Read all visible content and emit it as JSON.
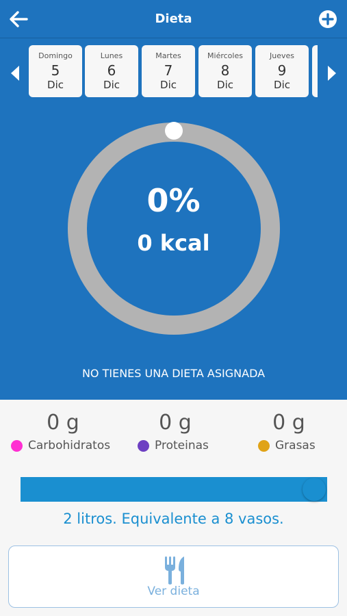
{
  "header": {
    "title": "Dieta",
    "back_icon": "arrow-left-icon",
    "add_icon": "plus-circle-icon"
  },
  "days": [
    {
      "name": "Domingo",
      "number": "5",
      "month": "Dic"
    },
    {
      "name": "Lunes",
      "number": "6",
      "month": "Dic"
    },
    {
      "name": "Martes",
      "number": "7",
      "month": "Dic"
    },
    {
      "name": "Miércoles",
      "number": "8",
      "month": "Dic"
    },
    {
      "name": "Jueves",
      "number": "9",
      "month": "Dic"
    }
  ],
  "summary": {
    "percent_label": "0%",
    "percent_value": 0,
    "kcal": "0 kcal",
    "notice": "NO TIENES UNA DIETA ASIGNADA"
  },
  "macros": [
    {
      "value": "0 g",
      "label": "Carbohidratos",
      "color": "#ff2fd2"
    },
    {
      "value": "0 g",
      "label": "Proteinas",
      "color": "#6d3fc2"
    },
    {
      "value": "0 g",
      "label": "Grasas",
      "color": "#e0a317"
    }
  ],
  "water": {
    "text": "2 litros. Equivalente a 8 vasos.",
    "fill_fraction": 1.0
  },
  "diet_button": {
    "label": "Ver dieta",
    "icon": "cutlery-icon"
  },
  "colors": {
    "primary": "#1e73be",
    "ring_track": "#b3b3b3",
    "water": "#1a8fd0",
    "button_text": "#7ab0dd"
  }
}
